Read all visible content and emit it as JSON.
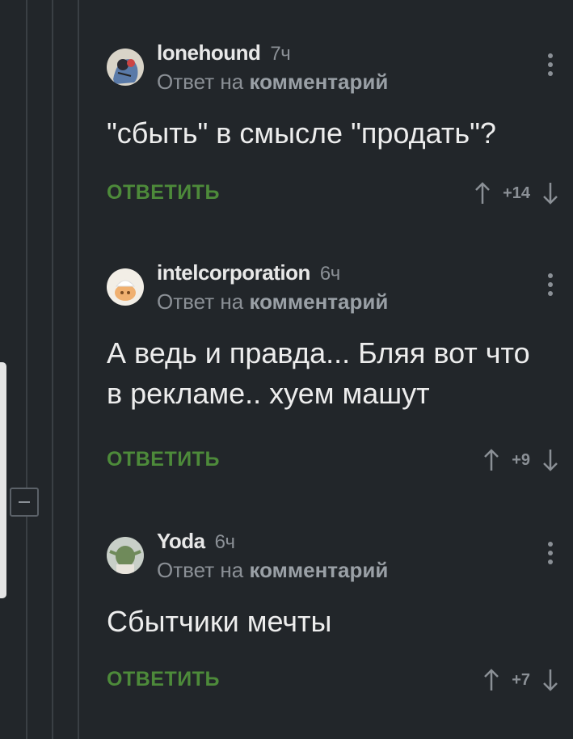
{
  "comments": [
    {
      "author": "lonehound",
      "time": "7ч",
      "reply_prefix": "Ответ на",
      "reply_target": "комментарий",
      "text": "\"сбыть\" в смысле \"продать\"?",
      "reply_label": "ОТВЕТИТЬ",
      "score": "+14"
    },
    {
      "author": "intelcorporation",
      "time": "6ч",
      "reply_prefix": "Ответ на",
      "reply_target": "комментарий",
      "text": "А ведь и правда... Бляя вот что в рекламе.. хуем машут",
      "reply_label": "ОТВЕТИТЬ",
      "score": "+9"
    },
    {
      "author": "Yoda",
      "time": "6ч",
      "reply_prefix": "Ответ на",
      "reply_target": "комментарий",
      "text": "Сбытчики мечты",
      "reply_label": "ОТВЕТИТЬ",
      "score": "+7"
    }
  ],
  "colors": {
    "background": "#22262a",
    "reply_button": "#4d8a3a",
    "muted_text": "#8b9096"
  },
  "icons": [
    "collapse-icon",
    "more-vertical-icon",
    "arrow-up-icon",
    "arrow-down-icon"
  ]
}
